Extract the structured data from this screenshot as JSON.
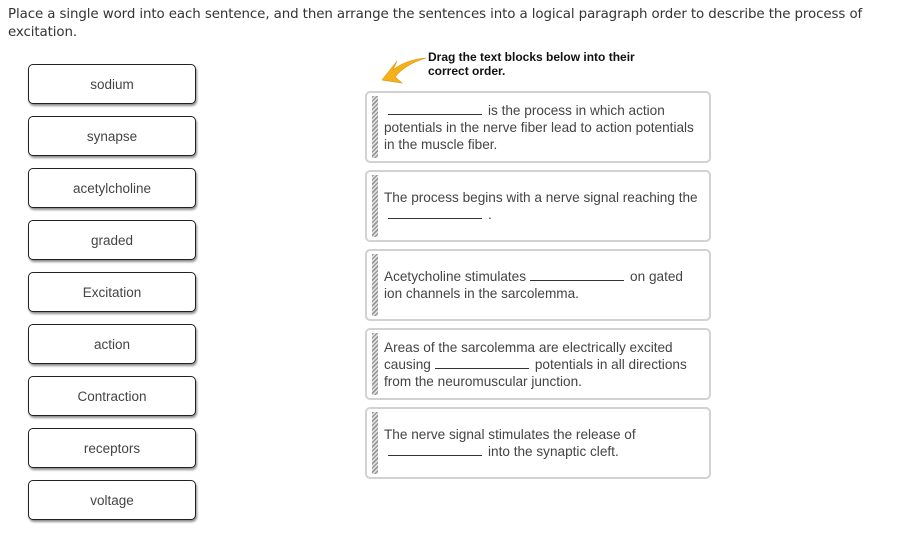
{
  "instructions": "Place a single word into each sentence, and then arrange the sentences into a logical paragraph order to describe the process of excitation.",
  "word_bank": [
    {
      "label": "sodium"
    },
    {
      "label": "synapse"
    },
    {
      "label": "acetylcholine"
    },
    {
      "label": "graded"
    },
    {
      "label": "Excitation"
    },
    {
      "label": "action"
    },
    {
      "label": "Contraction"
    },
    {
      "label": "receptors"
    },
    {
      "label": "voltage"
    }
  ],
  "hint": {
    "line1": "Drag the text blocks below into their",
    "line2": "correct order.",
    "arrow_color": "#f5b01a"
  },
  "sentences": [
    {
      "before": "",
      "after": "is the process in which action potentials in the nerve fiber lead to action potentials in the muscle fiber."
    },
    {
      "before": "The process begins with a nerve signal reaching the",
      "after": "."
    },
    {
      "before": "Acetycholine stimulates",
      "after": "on gated ion channels in the sarcolemma."
    },
    {
      "before": "Areas of the sarcolemma are electrically excited causing",
      "after": "potentials in all directions from the neuromuscular junction."
    },
    {
      "before": "The nerve signal stimulates the release of",
      "after": "into the synaptic cleft."
    }
  ]
}
